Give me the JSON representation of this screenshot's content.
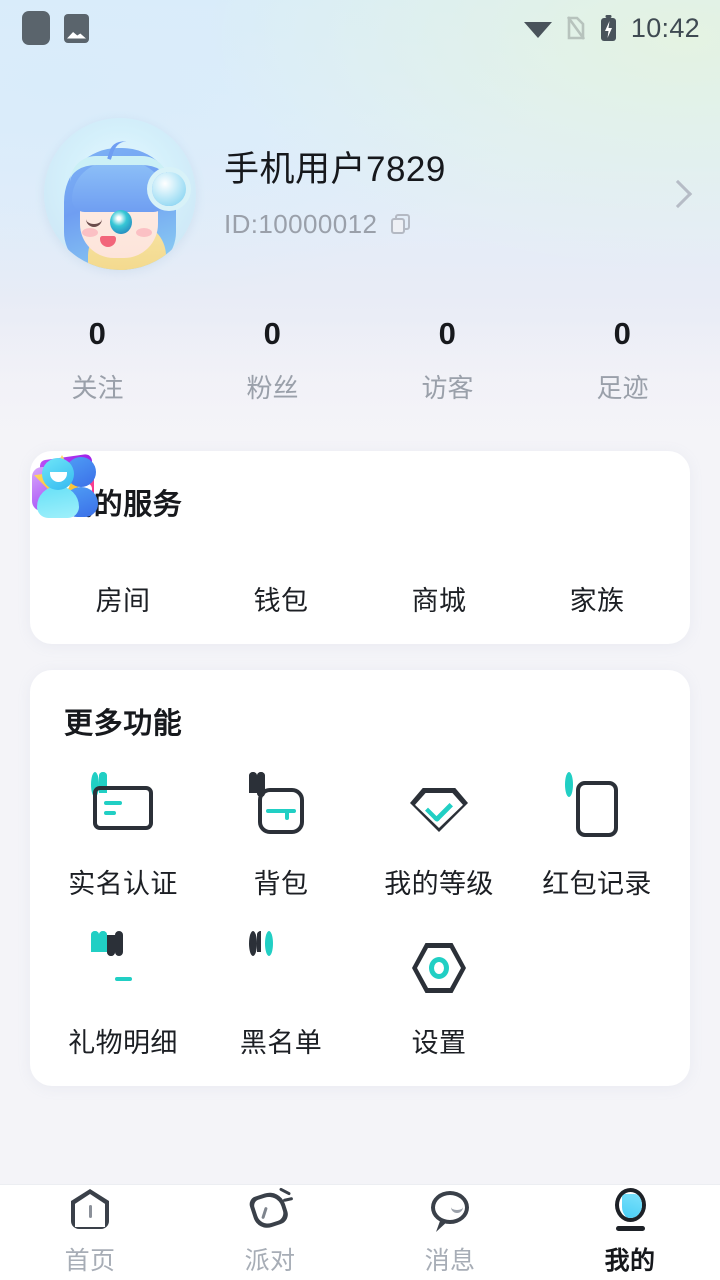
{
  "status_bar": {
    "time": "10:42",
    "left_icons": [
      "app-square-icon",
      "image-icon"
    ],
    "right_icons": [
      "wifi-icon",
      "sim-off-icon",
      "battery-charging-icon"
    ]
  },
  "profile": {
    "avatar": "anime-girl-avatar",
    "name": "手机用户7829",
    "id": "ID:10000012",
    "copy_icon": "copy-icon",
    "chevron": "chevron-right-icon"
  },
  "stats": [
    {
      "value": "0",
      "label": "关注"
    },
    {
      "value": "0",
      "label": "粉丝"
    },
    {
      "value": "0",
      "label": "访客"
    },
    {
      "value": "0",
      "label": "足迹"
    }
  ],
  "services": {
    "title": "我的服务",
    "items": [
      {
        "label": "房间",
        "icon": "house-icon",
        "color": "#fb2d86"
      },
      {
        "label": "钱包",
        "icon": "wallet-icon",
        "color": "#9c3df2"
      },
      {
        "label": "商城",
        "icon": "star-icon",
        "color": "#f7b323"
      },
      {
        "label": "家族",
        "icon": "family-icon",
        "color": "#35b9f0"
      }
    ]
  },
  "more_functions": {
    "title": "更多功能",
    "items": [
      {
        "label": "实名认证",
        "icon": "id-card-icon"
      },
      {
        "label": "背包",
        "icon": "backpack-icon"
      },
      {
        "label": "我的等级",
        "icon": "level-diamond-icon"
      },
      {
        "label": "红包记录",
        "icon": "red-packet-icon"
      },
      {
        "label": "礼物明细",
        "icon": "gift-box-icon"
      },
      {
        "label": "黑名单",
        "icon": "blocked-user-icon"
      },
      {
        "label": "设置",
        "icon": "settings-hexagon-icon"
      }
    ],
    "accent_color": "#21cfc4",
    "outline_color": "#2b3038"
  },
  "tabbar": {
    "tabs": [
      {
        "label": "首页",
        "icon": "home-icon",
        "active": false
      },
      {
        "label": "派对",
        "icon": "party-icon",
        "active": false
      },
      {
        "label": "消息",
        "icon": "message-icon",
        "active": false
      },
      {
        "label": "我的",
        "icon": "profile-icon",
        "active": true
      }
    ]
  }
}
